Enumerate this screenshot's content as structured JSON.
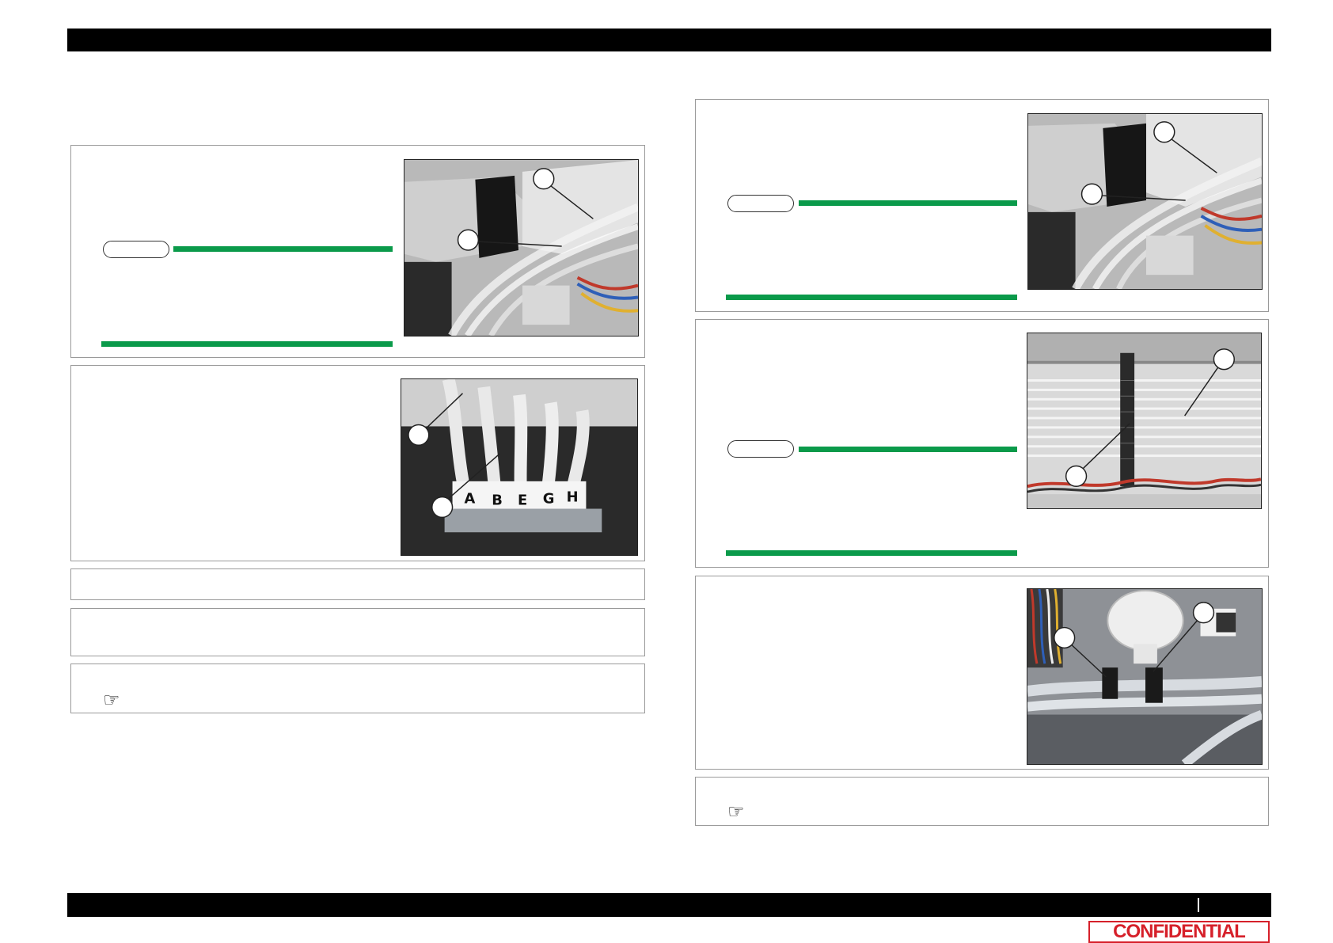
{
  "colors": {
    "header_bar": "#000000",
    "note_rule": "#0a9a4a",
    "confidential": "#d6202a"
  },
  "footer": {
    "confidential_label": "CONFIDENTIAL"
  },
  "icons": {
    "reference": "pointing-hand-icon",
    "note": "note-pill-icon"
  },
  "photos": {
    "photo2_labels": [
      "A",
      "B",
      "E",
      "G",
      "H"
    ]
  }
}
